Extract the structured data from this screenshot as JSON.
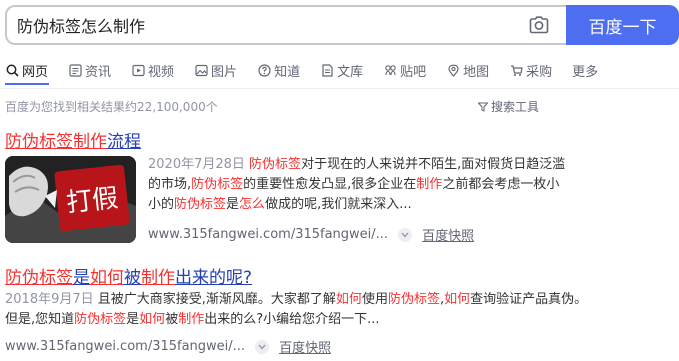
{
  "search": {
    "query": "防伪标签怎么制作",
    "button_label": "百度一下"
  },
  "tabs": [
    {
      "label": "网页",
      "icon": "search-icon"
    },
    {
      "label": "资讯",
      "icon": "news-icon"
    },
    {
      "label": "视频",
      "icon": "video-icon"
    },
    {
      "label": "图片",
      "icon": "image-icon"
    },
    {
      "label": "知道",
      "icon": "question-icon"
    },
    {
      "label": "文库",
      "icon": "document-icon"
    },
    {
      "label": "贴吧",
      "icon": "tieba-icon"
    },
    {
      "label": "地图",
      "icon": "map-icon"
    },
    {
      "label": "采购",
      "icon": "cart-icon"
    },
    {
      "label": "更多",
      "icon": ""
    }
  ],
  "stats": {
    "text": "百度为您找到相关结果约22,100,000个",
    "tools_label": "搜索工具"
  },
  "results": [
    {
      "title_parts": [
        {
          "text": "防伪标签制作",
          "hl": true
        },
        {
          "text": "流程",
          "hl": false
        }
      ],
      "date": "2020年7月28日",
      "abstract_parts": [
        {
          "text": "防伪标签",
          "hl": true
        },
        {
          "text": "对于现在的人来说并不陌生,面对假货日趋泛滥的市场,",
          "hl": false
        },
        {
          "text": "防伪标签",
          "hl": true
        },
        {
          "text": "的重要性愈发凸显,很多企业在",
          "hl": false
        },
        {
          "text": "制作",
          "hl": true
        },
        {
          "text": "之前都会考虑一枚小小的",
          "hl": false
        },
        {
          "text": "防伪标签",
          "hl": true
        },
        {
          "text": "是",
          "hl": false
        },
        {
          "text": "怎么",
          "hl": true
        },
        {
          "text": "做成的呢,我们就来深入...",
          "hl": false
        }
      ],
      "url": "www.315fangwei.com/315fangwei/...",
      "snapshot": "百度快照",
      "thumb_text": "打假"
    },
    {
      "title_parts": [
        {
          "text": "防伪标签",
          "hl": true
        },
        {
          "text": "是",
          "hl": false
        },
        {
          "text": "如何",
          "hl": true
        },
        {
          "text": "被",
          "hl": false
        },
        {
          "text": "制作",
          "hl": true
        },
        {
          "text": "出来的呢?",
          "hl": false
        }
      ],
      "date": "2018年9月7日",
      "abstract_parts": [
        {
          "text": "且被广大商家接受,渐渐风靡。大家都了解",
          "hl": false
        },
        {
          "text": "如何",
          "hl": true
        },
        {
          "text": "使用",
          "hl": false
        },
        {
          "text": "防伪标签",
          "hl": true
        },
        {
          "text": ",",
          "hl": false
        },
        {
          "text": "如何",
          "hl": true
        },
        {
          "text": "查询验证产品真伪。但是,您知道",
          "hl": false
        },
        {
          "text": "防伪标签",
          "hl": true
        },
        {
          "text": "是",
          "hl": false
        },
        {
          "text": "如何",
          "hl": true
        },
        {
          "text": "被",
          "hl": false
        },
        {
          "text": "制作",
          "hl": true
        },
        {
          "text": "出来的么?小编给您介绍一下...",
          "hl": false
        }
      ],
      "url": "www.315fangwei.com/315fangwei/...",
      "snapshot": "百度快照"
    }
  ],
  "colors": {
    "accent": "#4e6ef2",
    "link": "#2440b3",
    "highlight": "#f73131"
  }
}
